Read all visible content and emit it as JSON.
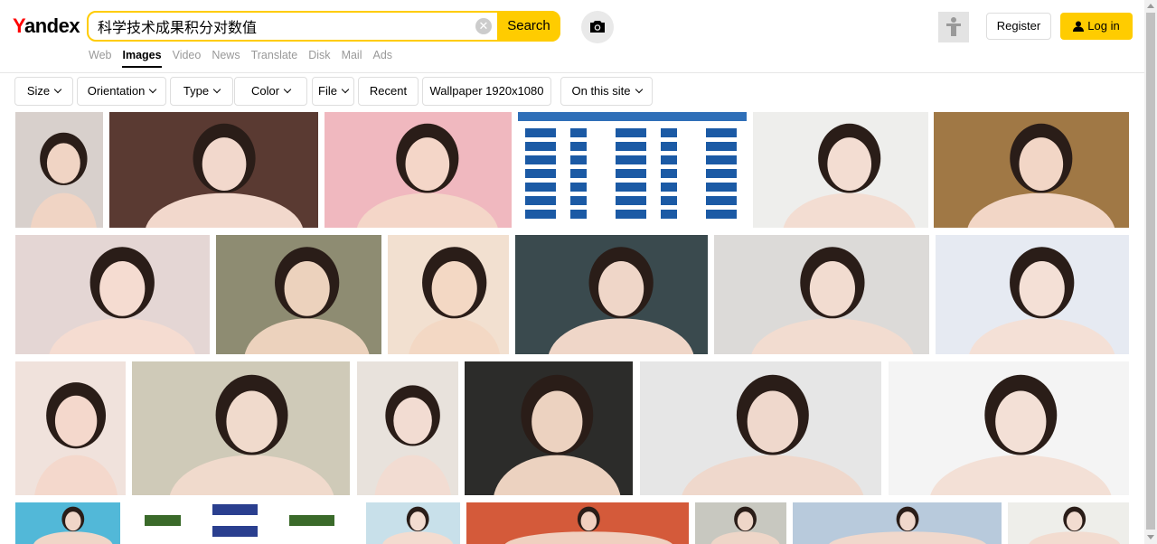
{
  "logo": {
    "first_letter": "Y",
    "rest": "andex"
  },
  "search": {
    "value": "科学技术成果积分对数值",
    "button_label": "Search",
    "clear_symbol": "✕"
  },
  "nav": {
    "items": [
      "Web",
      "Images",
      "Video",
      "News",
      "Translate",
      "Disk",
      "Mail",
      "Ads"
    ],
    "active": "Images"
  },
  "account": {
    "register_label": "Register",
    "login_label": "Log in"
  },
  "filters": [
    {
      "label": "Size",
      "has_dropdown": true
    },
    {
      "label": "Orientation",
      "has_dropdown": true
    },
    {
      "label": "Type",
      "has_dropdown": true
    },
    {
      "label": "Color",
      "has_dropdown": true
    },
    {
      "label": "File",
      "has_dropdown": true
    },
    {
      "label": "Recent",
      "has_dropdown": false
    },
    {
      "label": "Wallpaper 1920x1080",
      "has_dropdown": false
    },
    {
      "label": "On this site",
      "has_dropdown": true
    }
  ],
  "colors": {
    "accent": "#ffcc00",
    "brand_red": "#ff0000",
    "nav_inactive": "#999999"
  },
  "images": [
    {
      "kind": "photo",
      "bg": "#d8d0cc",
      "skin": "#f0d4c4"
    },
    {
      "kind": "photo",
      "bg": "#5a3a32",
      "skin": "#f2d8cc"
    },
    {
      "kind": "photo",
      "bg": "#f0b8bf",
      "skin": "#f4d6c8"
    },
    {
      "kind": "diagram",
      "bg": "#ffffff",
      "skin": "#1b5aa5"
    },
    {
      "kind": "photo",
      "bg": "#eeeeec",
      "skin": "#f3ddd2"
    },
    {
      "kind": "photo",
      "bg": "#a07845",
      "skin": "#f2d6c6"
    },
    {
      "kind": "photo",
      "bg": "#e4d6d4",
      "skin": "#f5dcd1"
    },
    {
      "kind": "photo",
      "bg": "#8e8c72",
      "skin": "#ecd2bd"
    },
    {
      "kind": "photo",
      "bg": "#f2e0d0",
      "skin": "#f3d8c4"
    },
    {
      "kind": "photo",
      "bg": "#3a4a4e",
      "skin": "#efd6c8"
    },
    {
      "kind": "photo",
      "bg": "#dcdad8",
      "skin": "#f2dcd0"
    },
    {
      "kind": "photo",
      "bg": "#e6eaf2",
      "skin": "#f4e0d6"
    },
    {
      "kind": "photo",
      "bg": "#f0e2dc",
      "skin": "#f4d8cc"
    },
    {
      "kind": "photo",
      "bg": "#cfcab8",
      "skin": "#f0dacc"
    },
    {
      "kind": "photo",
      "bg": "#e8e2dc",
      "skin": "#f2dcd2"
    },
    {
      "kind": "photo",
      "bg": "#2c2c2a",
      "skin": "#ecd2c0"
    },
    {
      "kind": "photo",
      "bg": "#e6e6e6",
      "skin": "#efd8cc"
    },
    {
      "kind": "photo",
      "bg": "#f4f4f4",
      "skin": "#f3e0d6"
    },
    {
      "kind": "photo",
      "bg": "#52b8d8",
      "skin": "#f0d6c8"
    },
    {
      "kind": "diagram2",
      "bg": "#ffffff",
      "skin": "#3a6a2a"
    },
    {
      "kind": "photo",
      "bg": "#c8e0ea",
      "skin": "#f3dcd0"
    },
    {
      "kind": "photo",
      "bg": "#d45a3a",
      "skin": "#f0d0c0"
    },
    {
      "kind": "photo",
      "bg": "#c8c8c0",
      "skin": "#eed6c8"
    },
    {
      "kind": "photo",
      "bg": "#b8cadc",
      "skin": "#f0d8cc"
    },
    {
      "kind": "photo",
      "bg": "#eeeeea",
      "skin": "#f2dcd0"
    }
  ]
}
